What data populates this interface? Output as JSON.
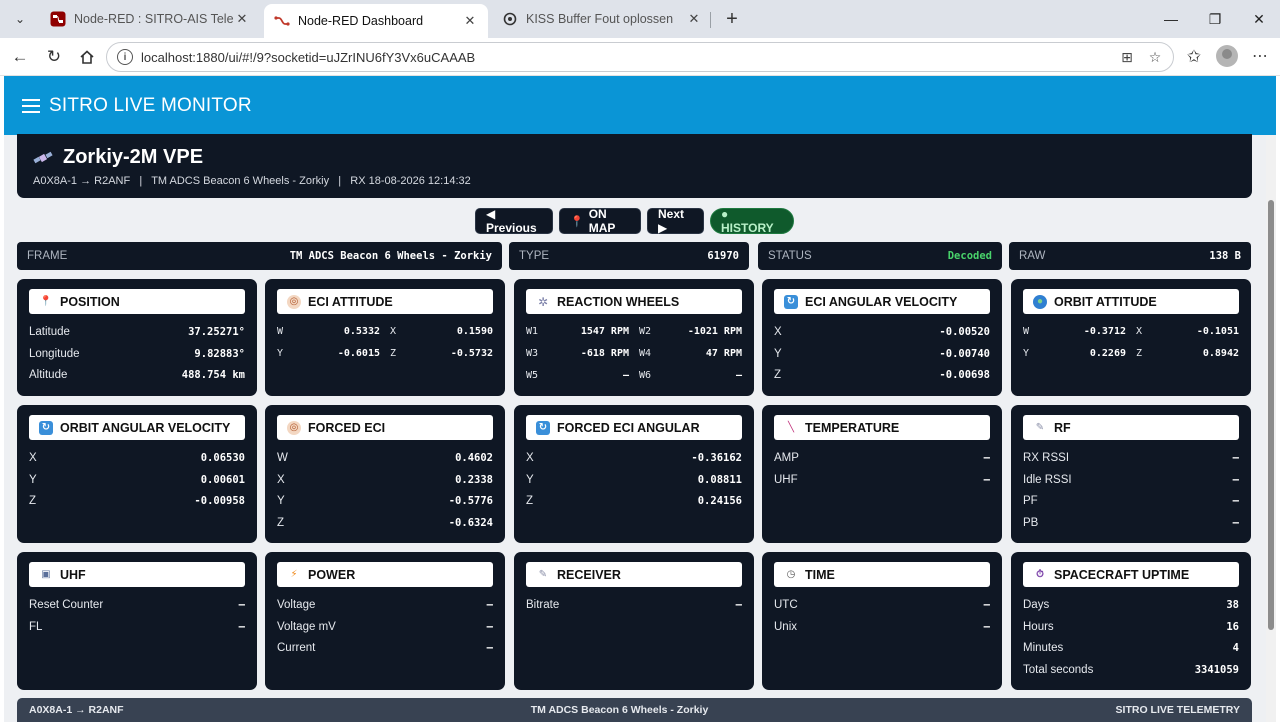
{
  "browser": {
    "tabs": [
      {
        "title": "Node-RED : SITRO-AIS Telemetry",
        "active": false
      },
      {
        "title": "Node-RED Dashboard",
        "active": true
      },
      {
        "title": "KISS Buffer Fout oplossen",
        "active": false
      }
    ],
    "url": "localhost:1880/ui/#!/9?socketid=uJZrINU6fY3Vx6uCAAAB"
  },
  "app": {
    "title": "SITRO LIVE MONITOR"
  },
  "header": {
    "sat_name": "Zorkiy-2M VPE",
    "meta": "A0X8A-1 → R2ANF   |   TM ADCS Beacon 6 Wheels - Zorkiy   |   RX 18-08-2026 12:14:32"
  },
  "actions": {
    "previous": "◀ Previous",
    "on_map": "ON MAP",
    "next": "Next ▶",
    "history": "● HISTORY"
  },
  "stripes": {
    "frame": {
      "label": "FRAME",
      "value": "TM ADCS Beacon 6 Wheels - Zorkiy"
    },
    "type": {
      "label": "TYPE",
      "value": "61970"
    },
    "status": {
      "label": "STATUS",
      "value": "Decoded"
    },
    "raw": {
      "label": "RAW",
      "value": "138 B"
    }
  },
  "cards": {
    "position": {
      "title": "POSITION",
      "rows": [
        {
          "k": "Latitude",
          "v": "37.25271°"
        },
        {
          "k": "Longitude",
          "v": "9.82883°"
        },
        {
          "k": "Altitude",
          "v": "488.754 km"
        }
      ]
    },
    "eci_attitude": {
      "title": "ECI ATTITUDE",
      "pairs": [
        {
          "k": "W",
          "v": "0.5332"
        },
        {
          "k": "X",
          "v": "0.1590"
        },
        {
          "k": "Y",
          "v": "-0.6015"
        },
        {
          "k": "Z",
          "v": "-0.5732"
        }
      ]
    },
    "reaction_wheels": {
      "title": "REACTION WHEELS",
      "pairs": [
        {
          "k": "W1",
          "v": "1547 RPM"
        },
        {
          "k": "W2",
          "v": "-1021 RPM"
        },
        {
          "k": "W3",
          "v": "-618 RPM"
        },
        {
          "k": "W4",
          "v": "47 RPM"
        },
        {
          "k": "W5",
          "v": "–"
        },
        {
          "k": "W6",
          "v": "–"
        }
      ]
    },
    "eci_angular_velocity": {
      "title": "ECI ANGULAR VELOCITY",
      "rows": [
        {
          "k": "X",
          "v": "-0.00520"
        },
        {
          "k": "Y",
          "v": "-0.00740"
        },
        {
          "k": "Z",
          "v": "-0.00698"
        }
      ]
    },
    "orbit_attitude": {
      "title": "ORBIT ATTITUDE",
      "pairs": [
        {
          "k": "W",
          "v": "-0.3712"
        },
        {
          "k": "X",
          "v": "-0.1051"
        },
        {
          "k": "Y",
          "v": "0.2269"
        },
        {
          "k": "Z",
          "v": "0.8942"
        }
      ]
    },
    "orbit_angular_velocity": {
      "title": "ORBIT ANGULAR VELOCITY",
      "rows": [
        {
          "k": "X",
          "v": "0.06530"
        },
        {
          "k": "Y",
          "v": "0.00601"
        },
        {
          "k": "Z",
          "v": "-0.00958"
        }
      ]
    },
    "forced_eci": {
      "title": "FORCED ECI",
      "rows": [
        {
          "k": "W",
          "v": "0.4602"
        },
        {
          "k": "X",
          "v": "0.2338"
        },
        {
          "k": "Y",
          "v": "-0.5776"
        },
        {
          "k": "Z",
          "v": "-0.6324"
        }
      ]
    },
    "forced_eci_angular": {
      "title": "FORCED ECI ANGULAR",
      "rows": [
        {
          "k": "X",
          "v": "-0.36162"
        },
        {
          "k": "Y",
          "v": "0.08811"
        },
        {
          "k": "Z",
          "v": "0.24156"
        }
      ]
    },
    "temperature": {
      "title": "TEMPERATURE",
      "rows": [
        {
          "k": "AMP",
          "v": "–"
        },
        {
          "k": "UHF",
          "v": "–"
        }
      ]
    },
    "rf": {
      "title": "RF",
      "rows": [
        {
          "k": "RX RSSI",
          "v": "–"
        },
        {
          "k": "Idle RSSI",
          "v": "–"
        },
        {
          "k": "PF",
          "v": "–"
        },
        {
          "k": "PB",
          "v": "–"
        }
      ]
    },
    "uhf": {
      "title": "UHF",
      "rows": [
        {
          "k": "Reset Counter",
          "v": "–"
        },
        {
          "k": "FL",
          "v": "–"
        }
      ]
    },
    "power": {
      "title": "POWER",
      "rows": [
        {
          "k": "Voltage",
          "v": "–"
        },
        {
          "k": "Voltage mV",
          "v": "–"
        },
        {
          "k": "Current",
          "v": "–"
        }
      ]
    },
    "receiver": {
      "title": "RECEIVER",
      "rows": [
        {
          "k": "Bitrate",
          "v": "–"
        }
      ]
    },
    "time": {
      "title": "TIME",
      "rows": [
        {
          "k": "UTC",
          "v": "–"
        },
        {
          "k": "Unix",
          "v": "–"
        }
      ]
    },
    "spacecraft_uptime": {
      "title": "SPACECRAFT UPTIME",
      "rows": [
        {
          "k": "Days",
          "v": "38"
        },
        {
          "k": "Hours",
          "v": "16"
        },
        {
          "k": "Minutes",
          "v": "4"
        },
        {
          "k": "Total seconds",
          "v": "3341059"
        }
      ]
    }
  },
  "footer": {
    "left": "A0X8A-1 → R2ANF",
    "center": "TM ADCS Beacon 6 Wheels - Zorkiy",
    "right": "SITRO LIVE TELEMETRY"
  },
  "colors": {
    "accent": "#0a95d6",
    "card_bg": "#0f1724",
    "status_ok": "#49d36b",
    "history_bg": "#0f5a2c"
  }
}
